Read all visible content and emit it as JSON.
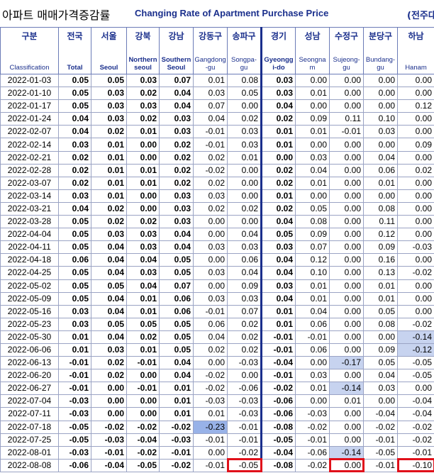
{
  "title": {
    "korean": "아파트 매매가격증감률",
    "english": "Changing Rate of Apartment Purchase Price",
    "unit": "(전주대비"
  },
  "columns": [
    {
      "ko": "구분",
      "en": "Classification"
    },
    {
      "ko": "전국",
      "en": "Total"
    },
    {
      "ko": "서울",
      "en": "Seoul"
    },
    {
      "ko": "강북",
      "en": "Northern seoul"
    },
    {
      "ko": "강남",
      "en": "Southern Seoul"
    },
    {
      "ko": "강동구",
      "en": "Gangdong -gu"
    },
    {
      "ko": "송파구",
      "en": "Songpa- gu"
    },
    {
      "ko": "경기",
      "en": "Gyeongg i-do"
    },
    {
      "ko": "성남",
      "en": "Seongna m"
    },
    {
      "ko": "수정구",
      "en": "Sujeong- gu"
    },
    {
      "ko": "분당구",
      "en": "Bundang- gu"
    },
    {
      "ko": "하남",
      "en": "Hanam"
    }
  ],
  "rows": [
    [
      "2022-01-03",
      "0.05",
      "0.05",
      "0.03",
      "0.07",
      "0.01",
      "0.08",
      "0.03",
      "0.00",
      "0.00",
      "0.00",
      "0.00"
    ],
    [
      "2022-01-10",
      "0.05",
      "0.03",
      "0.02",
      "0.04",
      "0.03",
      "0.05",
      "0.03",
      "0.01",
      "0.00",
      "0.00",
      "0.00"
    ],
    [
      "2022-01-17",
      "0.05",
      "0.03",
      "0.03",
      "0.04",
      "0.07",
      "0.00",
      "0.04",
      "0.00",
      "0.00",
      "0.00",
      "0.12"
    ],
    [
      "2022-01-24",
      "0.04",
      "0.03",
      "0.02",
      "0.03",
      "0.04",
      "0.02",
      "0.02",
      "0.09",
      "0.11",
      "0.10",
      "0.00"
    ],
    [
      "2022-02-07",
      "0.04",
      "0.02",
      "0.01",
      "0.03",
      "-0.01",
      "0.03",
      "0.01",
      "0.01",
      "-0.01",
      "0.03",
      "0.00"
    ],
    [
      "2022-02-14",
      "0.03",
      "0.01",
      "0.00",
      "0.02",
      "-0.01",
      "0.03",
      "0.01",
      "0.00",
      "0.00",
      "0.00",
      "0.09"
    ],
    [
      "2022-02-21",
      "0.02",
      "0.01",
      "0.00",
      "0.02",
      "0.02",
      "0.01",
      "0.00",
      "0.03",
      "0.00",
      "0.04",
      "0.00"
    ],
    [
      "2022-02-28",
      "0.02",
      "0.01",
      "0.01",
      "0.02",
      "-0.02",
      "0.00",
      "0.02",
      "0.04",
      "0.00",
      "0.06",
      "0.02"
    ],
    [
      "2022-03-07",
      "0.02",
      "0.01",
      "0.01",
      "0.02",
      "0.02",
      "0.00",
      "0.02",
      "0.01",
      "0.00",
      "0.01",
      "0.00"
    ],
    [
      "2022-03-14",
      "0.03",
      "0.01",
      "0.00",
      "0.03",
      "0.03",
      "0.00",
      "0.01",
      "0.00",
      "0.00",
      "0.00",
      "0.00"
    ],
    [
      "2022-03-21",
      "0.04",
      "0.02",
      "0.00",
      "0.03",
      "0.02",
      "0.02",
      "0.02",
      "0.05",
      "0.00",
      "0.08",
      "0.00"
    ],
    [
      "2022-03-28",
      "0.05",
      "0.02",
      "0.02",
      "0.03",
      "0.00",
      "0.00",
      "0.04",
      "0.08",
      "0.00",
      "0.11",
      "0.00"
    ],
    [
      "2022-04-04",
      "0.05",
      "0.03",
      "0.03",
      "0.04",
      "0.00",
      "0.04",
      "0.05",
      "0.09",
      "0.00",
      "0.12",
      "0.00"
    ],
    [
      "2022-04-11",
      "0.05",
      "0.04",
      "0.03",
      "0.04",
      "0.03",
      "0.03",
      "0.03",
      "0.07",
      "0.00",
      "0.09",
      "-0.03"
    ],
    [
      "2022-04-18",
      "0.06",
      "0.04",
      "0.04",
      "0.05",
      "0.00",
      "0.06",
      "0.04",
      "0.12",
      "0.00",
      "0.16",
      "0.00"
    ],
    [
      "2022-04-25",
      "0.05",
      "0.04",
      "0.03",
      "0.05",
      "0.03",
      "0.04",
      "0.04",
      "0.10",
      "0.00",
      "0.13",
      "-0.02"
    ],
    [
      "2022-05-02",
      "0.05",
      "0.05",
      "0.04",
      "0.07",
      "0.00",
      "0.09",
      "0.03",
      "0.01",
      "0.00",
      "0.01",
      "0.00"
    ],
    [
      "2022-05-09",
      "0.05",
      "0.04",
      "0.01",
      "0.06",
      "0.03",
      "0.03",
      "0.04",
      "0.01",
      "0.00",
      "0.01",
      "0.00"
    ],
    [
      "2022-05-16",
      "0.03",
      "0.04",
      "0.01",
      "0.06",
      "-0.01",
      "0.07",
      "0.01",
      "0.04",
      "0.00",
      "0.05",
      "0.00"
    ],
    [
      "2022-05-23",
      "0.03",
      "0.05",
      "0.05",
      "0.05",
      "0.06",
      "0.02",
      "0.01",
      "0.06",
      "0.00",
      "0.08",
      "-0.02"
    ],
    [
      "2022-05-30",
      "0.01",
      "0.04",
      "0.02",
      "0.05",
      "0.04",
      "0.02",
      "-0.01",
      "-0.01",
      "0.00",
      "0.00",
      "-0.14"
    ],
    [
      "2022-06-06",
      "0.01",
      "0.03",
      "0.01",
      "0.05",
      "0.02",
      "0.02",
      "-0.01",
      "0.06",
      "0.00",
      "0.09",
      "-0.12"
    ],
    [
      "2022-06-13",
      "-0.01",
      "0.02",
      "-0.01",
      "0.04",
      "0.00",
      "-0.03",
      "-0.04",
      "0.00",
      "-0.17",
      "0.05",
      "-0.05"
    ],
    [
      "2022-06-20",
      "-0.01",
      "0.02",
      "0.00",
      "0.04",
      "-0.02",
      "0.00",
      "-0.01",
      "0.03",
      "0.00",
      "0.04",
      "-0.05"
    ],
    [
      "2022-06-27",
      "-0.01",
      "0.00",
      "-0.01",
      "0.01",
      "-0.02",
      "-0.06",
      "-0.02",
      "0.01",
      "-0.14",
      "0.03",
      "0.00"
    ],
    [
      "2022-07-04",
      "-0.03",
      "0.00",
      "0.00",
      "0.01",
      "-0.03",
      "-0.03",
      "-0.06",
      "0.00",
      "0.01",
      "0.00",
      "-0.04"
    ],
    [
      "2022-07-11",
      "-0.03",
      "0.00",
      "0.00",
      "0.01",
      "0.01",
      "-0.03",
      "-0.06",
      "-0.03",
      "0.00",
      "-0.04",
      "-0.04"
    ],
    [
      "2022-07-18",
      "-0.05",
      "-0.02",
      "-0.02",
      "-0.02",
      "-0.23",
      "-0.01",
      "-0.08",
      "-0.02",
      "0.00",
      "-0.02",
      "-0.02"
    ],
    [
      "2022-07-25",
      "-0.05",
      "-0.03",
      "-0.04",
      "-0.03",
      "-0.01",
      "-0.01",
      "-0.05",
      "-0.01",
      "0.00",
      "-0.01",
      "-0.02"
    ],
    [
      "2022-08-01",
      "-0.03",
      "-0.01",
      "-0.02",
      "-0.01",
      "0.00",
      "-0.02",
      "-0.04",
      "-0.06",
      "-0.14",
      "-0.05",
      "-0.01"
    ],
    [
      "2022-08-08",
      "-0.06",
      "-0.04",
      "-0.05",
      "-0.02",
      "-0.01",
      "-0.05",
      "-0.08",
      "-0.02",
      "0.00",
      "-0.01",
      "-0.10"
    ]
  ],
  "highlight_color": "#c7d3ef",
  "strong_highlight_color": "#98b2e8",
  "box_color": "#e0101a",
  "header_text_color": "#1a2f8c"
}
